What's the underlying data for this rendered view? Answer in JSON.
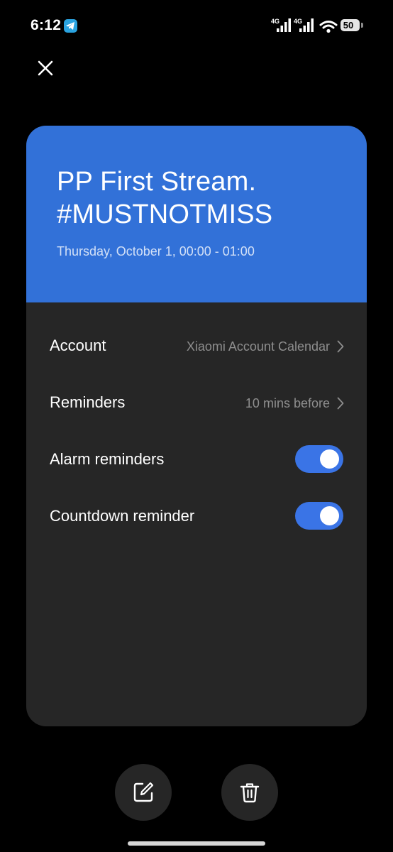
{
  "status_bar": {
    "time": "6:12",
    "network_1": "4G",
    "network_2": "4G",
    "battery": "50",
    "icons": [
      "telegram-icon",
      "signal-icon",
      "signal-icon",
      "wifi-icon",
      "battery-icon"
    ]
  },
  "close_icon": "close-icon",
  "event": {
    "title": "PP First Stream. #MUSTNOTMISS",
    "datetime": "Thursday, October 1, 00:00 - 01:00",
    "header_color": "#3271d8"
  },
  "details": {
    "account": {
      "label": "Account",
      "value": "Xiaomi Account Calendar"
    },
    "reminders": {
      "label": "Reminders",
      "value": "10 mins before"
    },
    "alarm_reminders": {
      "label": "Alarm reminders",
      "enabled": true
    },
    "countdown_reminder": {
      "label": "Countdown reminder",
      "enabled": true
    },
    "toggle_on_color": "#3a74e6"
  },
  "actions": {
    "edit_icon": "edit-icon",
    "delete_icon": "trash-icon"
  }
}
